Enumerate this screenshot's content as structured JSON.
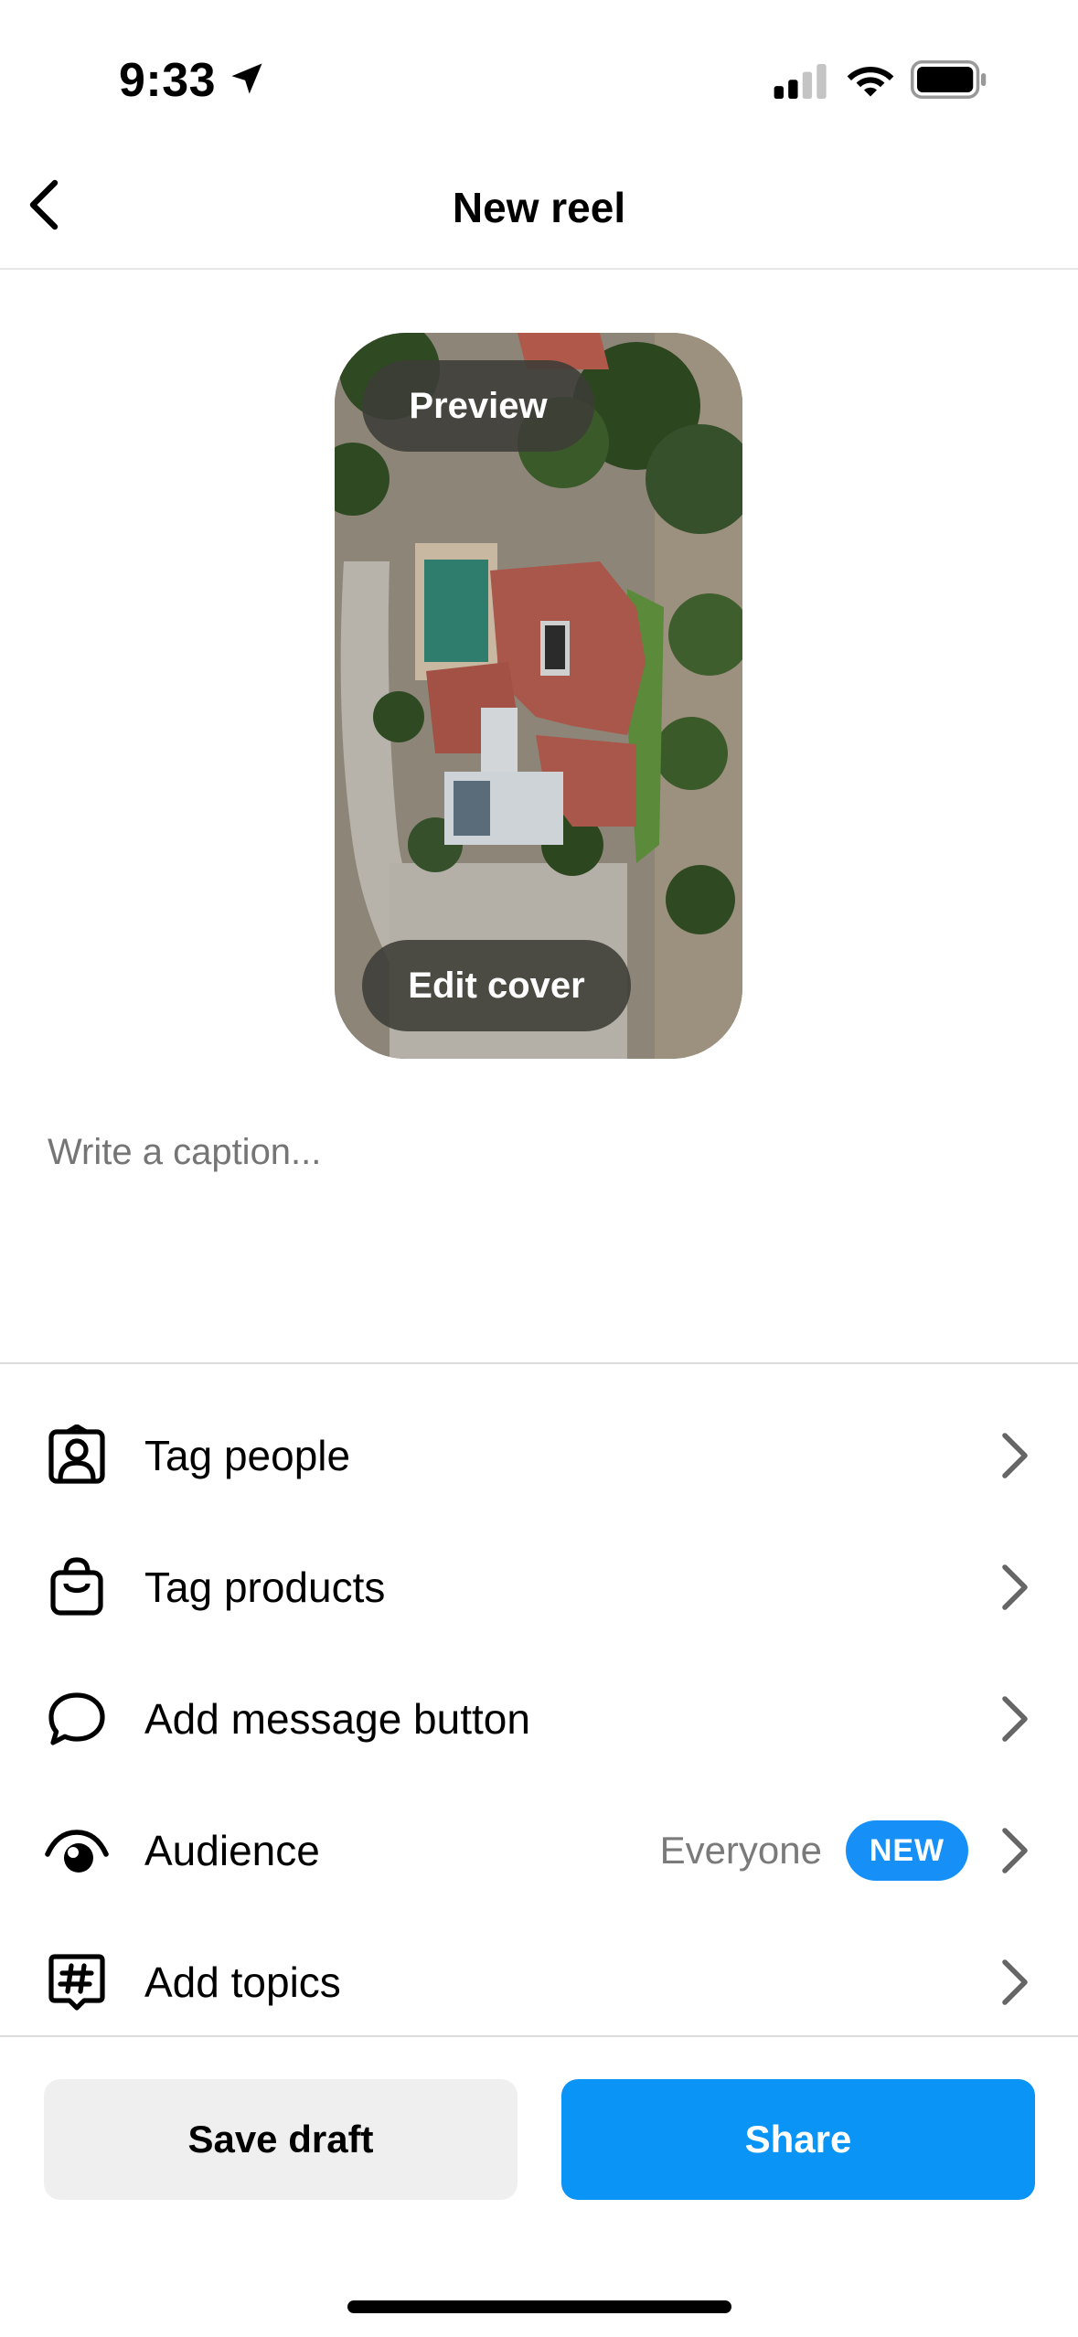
{
  "status_bar": {
    "time": "9:33",
    "icons": [
      "location-arrow-icon",
      "cellular-signal-icon",
      "wifi-icon",
      "battery-icon"
    ]
  },
  "header": {
    "title": "New reel",
    "back_icon": "chevron-left-icon"
  },
  "cover": {
    "preview_label": "Preview",
    "edit_cover_label": "Edit cover"
  },
  "caption": {
    "placeholder": "Write a caption..."
  },
  "options": [
    {
      "label": "Tag people",
      "icon": "tag-people-icon"
    },
    {
      "label": "Tag products",
      "icon": "shopping-bag-icon"
    },
    {
      "label": "Add message button",
      "icon": "speech-bubble-icon"
    },
    {
      "label": "Audience",
      "icon": "eye-icon",
      "value": "Everyone",
      "badge": "NEW"
    },
    {
      "label": "Add topics",
      "icon": "hashtag-icon"
    }
  ],
  "footer": {
    "save_draft_label": "Save draft",
    "share_label": "Share"
  },
  "colors": {
    "accent": "#0a95f6",
    "badge": "#1690f7",
    "secondary_button": "#efefef"
  }
}
